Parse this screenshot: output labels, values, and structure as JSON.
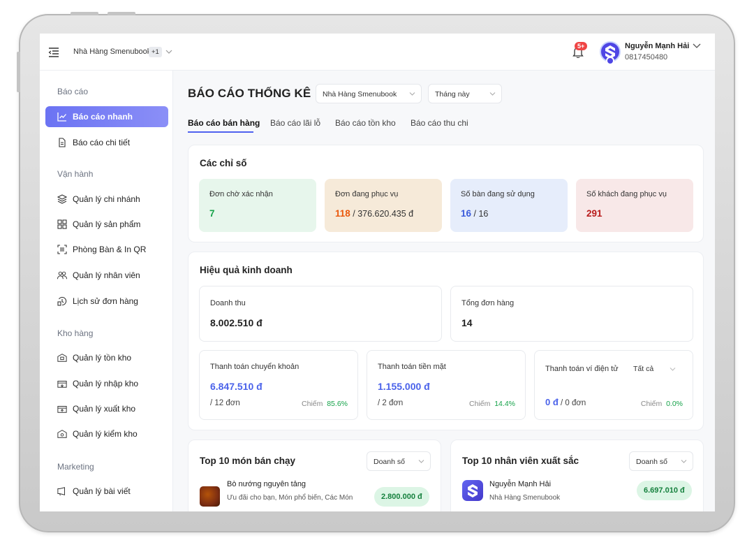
{
  "header": {
    "store_name": "Nhà Hàng Smenubook",
    "store_extra": "+1",
    "notification_count": "5+",
    "user_name": "Nguyễn Mạnh Hải",
    "user_phone": "0817450480"
  },
  "sidebar": {
    "sections": [
      {
        "label": "Báo cáo"
      },
      {
        "label": "Vận hành"
      },
      {
        "label": "Kho hàng"
      },
      {
        "label": "Marketing"
      }
    ],
    "items": [
      {
        "label": "Báo cáo nhanh",
        "icon": "chart-line-icon",
        "active": true
      },
      {
        "label": "Báo cáo chi tiết",
        "icon": "document-icon"
      },
      {
        "label": "Quản lý chi nhánh",
        "icon": "layers-icon"
      },
      {
        "label": "Quản lý sản phẩm",
        "icon": "grid-icon"
      },
      {
        "label": "Phòng Bàn & In QR",
        "icon": "qr-icon"
      },
      {
        "label": "Quản lý nhân viên",
        "icon": "users-icon"
      },
      {
        "label": "Lịch sử đơn hàng",
        "icon": "history-icon"
      },
      {
        "label": "Quản lý tồn kho",
        "icon": "warehouse-icon"
      },
      {
        "label": "Quản lý nhập kho",
        "icon": "import-box-icon"
      },
      {
        "label": "Quản lý xuất kho",
        "icon": "export-box-icon"
      },
      {
        "label": "Quản lý kiểm kho",
        "icon": "inspect-warehouse-icon"
      },
      {
        "label": "Quản lý bài viết",
        "icon": "megaphone-icon"
      }
    ]
  },
  "main": {
    "title": "BÁO CÁO THỐNG KÊ",
    "store_select": "Nhà Hàng Smenubook",
    "period_select": "Tháng này",
    "tabs": [
      {
        "label": "Báo cáo bán hàng",
        "active": true
      },
      {
        "label": "Báo cáo lãi lỗ"
      },
      {
        "label": "Báo cáo tồn kho"
      },
      {
        "label": "Báo cáo thu chi"
      }
    ],
    "indicators": {
      "title": "Các chỉ số",
      "cards": [
        {
          "label": "Đơn chờ xác nhận",
          "value": "7",
          "rest": "",
          "color": "#16a34a",
          "bg": "#e7f6ec"
        },
        {
          "label": "Đơn đang phục vụ",
          "value": "118",
          "rest": " / 376.620.435 đ",
          "color": "#ea580c",
          "bg": "#f6ead9"
        },
        {
          "label": "Số bàn đang sử dụng",
          "value": "16",
          "rest": " / 16",
          "color": "#3b5bdb",
          "bg": "#e6edfb"
        },
        {
          "label": "Số khách đang phục vụ",
          "value": "291",
          "rest": "",
          "color": "#b91c1c",
          "bg": "#f8e8e8"
        }
      ]
    },
    "business": {
      "title": "Hiệu quả kinh doanh",
      "revenue_label": "Doanh thu",
      "revenue_value": "8.002.510 đ",
      "orders_label": "Tổng đơn hàng",
      "orders_value": "14",
      "transfer": {
        "label": "Thanh toán chuyển khoản",
        "value": "6.847.510 đ",
        "orders": "/ 12 đơn",
        "share_label": "Chiếm",
        "share": "85.6%"
      },
      "cash": {
        "label": "Thanh toán tiền mặt",
        "value": "1.155.000 đ",
        "orders": "/ 2 đơn",
        "share_label": "Chiếm",
        "share": "14.4%"
      },
      "ewallet": {
        "label": "Thanh toán ví điện tử",
        "filter": "Tất cả",
        "value": "0 đ",
        "orders": "/ 0 đơn",
        "share_label": "Chiếm",
        "share": "0.0%"
      }
    },
    "top_dishes": {
      "title": "Top 10 món bán chạy",
      "sort": "Doanh số",
      "items": [
        {
          "name": "Bò nướng nguyên tảng",
          "sub": "Ưu đãi cho bạn, Món phổ biến, Các Món",
          "value": "2.800.000 đ"
        }
      ]
    },
    "top_staff": {
      "title": "Top 10 nhân viên xuất sắc",
      "sort": "Doanh số",
      "items": [
        {
          "name": "Nguyễn Mạnh Hải",
          "sub": "Nhà Hàng Smenubook",
          "value": "6.697.010 đ"
        }
      ]
    }
  }
}
